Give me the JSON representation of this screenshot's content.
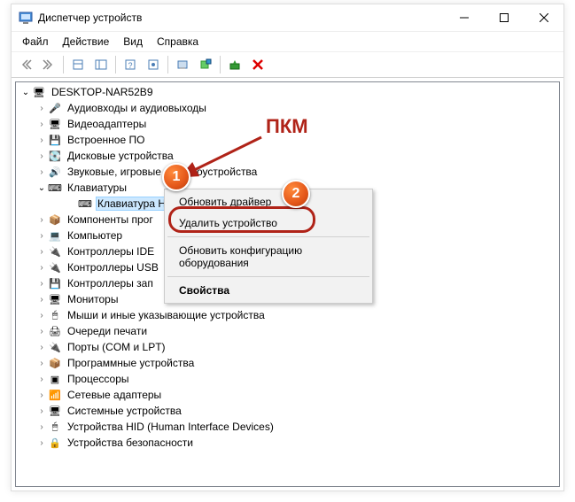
{
  "window": {
    "title": "Диспетчер устройств"
  },
  "menu": {
    "file": "Файл",
    "action": "Действие",
    "view": "Вид",
    "help": "Справка"
  },
  "root": {
    "name": "DESKTOP-NAR52B9"
  },
  "categories": [
    {
      "label": "Аудиовходы и аудиовыходы"
    },
    {
      "label": "Видеоадаптеры"
    },
    {
      "label": "Встроенное ПО"
    },
    {
      "label": "Дисковые устройства"
    },
    {
      "label": "Звуковые, игровые и видеоустройства"
    },
    {
      "label": "Клавиатуры",
      "open": true
    },
    {
      "label": "Клавиатура HID",
      "child": true,
      "selected": true
    },
    {
      "label": "Компоненты прог"
    },
    {
      "label": "Компьютер"
    },
    {
      "label": "Контроллеры IDE "
    },
    {
      "label": "Контроллеры USB"
    },
    {
      "label": "Контроллеры зап"
    },
    {
      "label": "Мониторы"
    },
    {
      "label": "Мыши и иные указывающие устройства"
    },
    {
      "label": "Очереди печати"
    },
    {
      "label": "Порты (COM и LPT)"
    },
    {
      "label": "Программные устройства"
    },
    {
      "label": "Процессоры"
    },
    {
      "label": "Сетевые адаптеры"
    },
    {
      "label": "Системные устройства"
    },
    {
      "label": "Устройства HID (Human Interface Devices)"
    },
    {
      "label": "Устройства безопасности"
    }
  ],
  "context_menu": {
    "update": "Обновить драйвер",
    "remove": "Удалить устройство",
    "rescan": "Обновить конфигурацию оборудования",
    "props": "Свойства"
  },
  "annotation": {
    "label": "ПКМ",
    "badge1": "1",
    "badge2": "2"
  },
  "icons": {
    "audio": "🎤",
    "video": "🖥",
    "firmware": "💾",
    "disk": "💽",
    "sound": "🔊",
    "keyboard": "⌨",
    "software": "📦",
    "computer": "💻",
    "ide": "🔌",
    "usb": "🔌",
    "storage": "💾",
    "monitor": "🖥",
    "mouse": "🖱",
    "print": "🖨",
    "port": "🔌",
    "cpu": "▣",
    "net": "📶",
    "system": "🖥",
    "hid": "🖱",
    "security": "🔒",
    "root": "🖥"
  }
}
